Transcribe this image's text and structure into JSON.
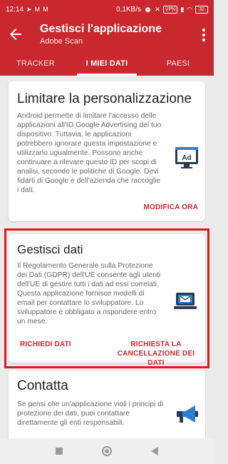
{
  "status_bar": {
    "time": "12:14",
    "network_speed": "0,1KB/s",
    "vpn": "VPN",
    "battery": "32"
  },
  "app_bar": {
    "title": "Gestisci l'applicazione",
    "subtitle": "Adobe Scan"
  },
  "tabs": [
    {
      "label": "TRACKER",
      "selected": false
    },
    {
      "label": "I MIEI DATI",
      "selected": true
    },
    {
      "label": "PAESI",
      "selected": false
    }
  ],
  "cards": [
    {
      "title": "Limitare la personalizzazione",
      "body": "Android permette di limitare l'accesso delle applicazioni all'ID Google Advertising del tuo dispositivo. Tuttavia, le applicazioni potrebbero ignorare questa impostazione e utilizzarlo ugualmente. Possono anche continuare a rilevare questo ID per scopi di analisi, secondo le politiche di Google. Devi fidarti di Google e dell'azienda che raccoglie i dati.",
      "icon": "ad-icon",
      "action": "MODIFICA ORA"
    },
    {
      "title": "Gestisci dati",
      "body": "Il Regolamento Generale sulla Protezione dei Dati (GDPR) dell'UE consente agli utenti dell'UE di gestire tutti i dati ad essi correlati. Questa applicazione fornisce modelli di email per contattare lo sviluppatore. Lo sviluppatore è obbligato a rispondere entro un mese.",
      "icon": "laptop-email-icon",
      "action_1": "RICHIEDI DATI",
      "action_2": "RICHIESTA LA CANCELLAZIONE DEI DATI"
    },
    {
      "title": "Contatta",
      "body": "Se pensi che un'applicazione violi i principi di protezione dei dati, puoi contattare direttamente gli enti responsabili.",
      "icon": "megaphone-icon"
    }
  ],
  "colors": {
    "brand": "#c8282e",
    "highlight": "#e0191e",
    "icon_dark": "#2b3a55",
    "icon_blue": "#2a7fd4"
  }
}
